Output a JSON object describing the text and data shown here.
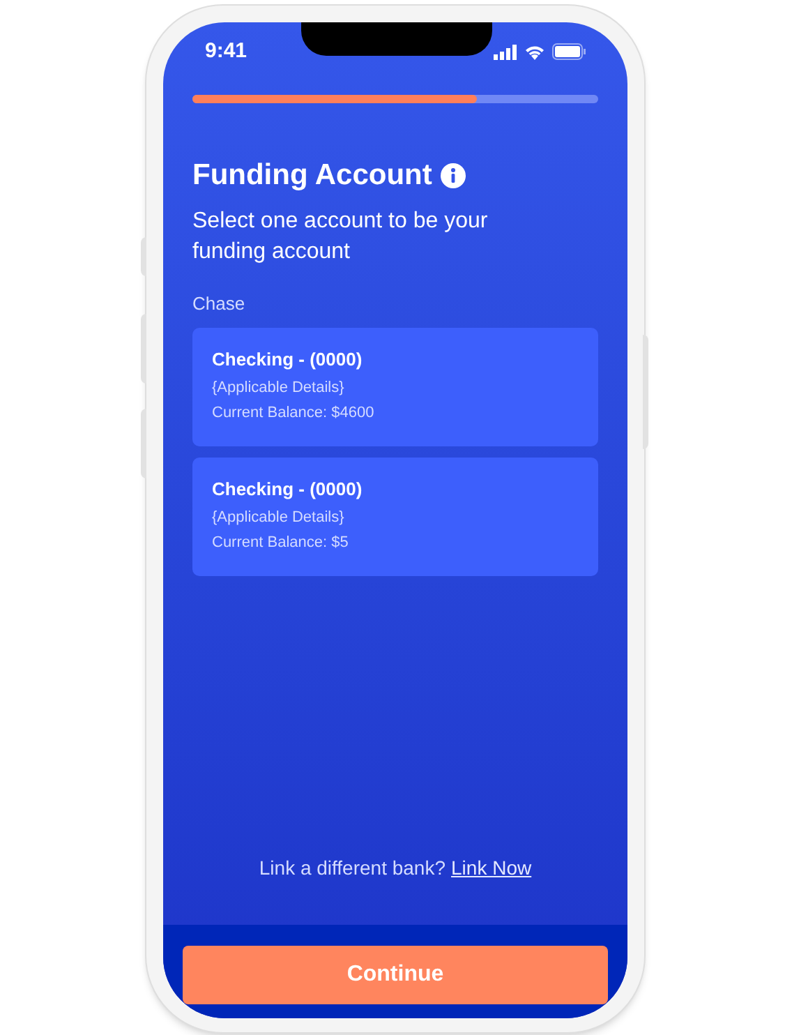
{
  "status_bar": {
    "time": "9:41"
  },
  "progress": {
    "level": 0.7
  },
  "title": "Funding Account",
  "subtitle": "Select one account to be your funding account",
  "bank": "Chase",
  "accounts": [
    {
      "name": "Checking - (0000)",
      "details": "{Applicable Details}",
      "balance": "Current Balance: $4600"
    },
    {
      "name": "Checking - (0000)",
      "details": "{Applicable Details}",
      "balance": "Current Balance: $5"
    }
  ],
  "link_prompt": {
    "text": "Link a different bank?",
    "link": "Link Now"
  },
  "continue_button": "Continue"
}
